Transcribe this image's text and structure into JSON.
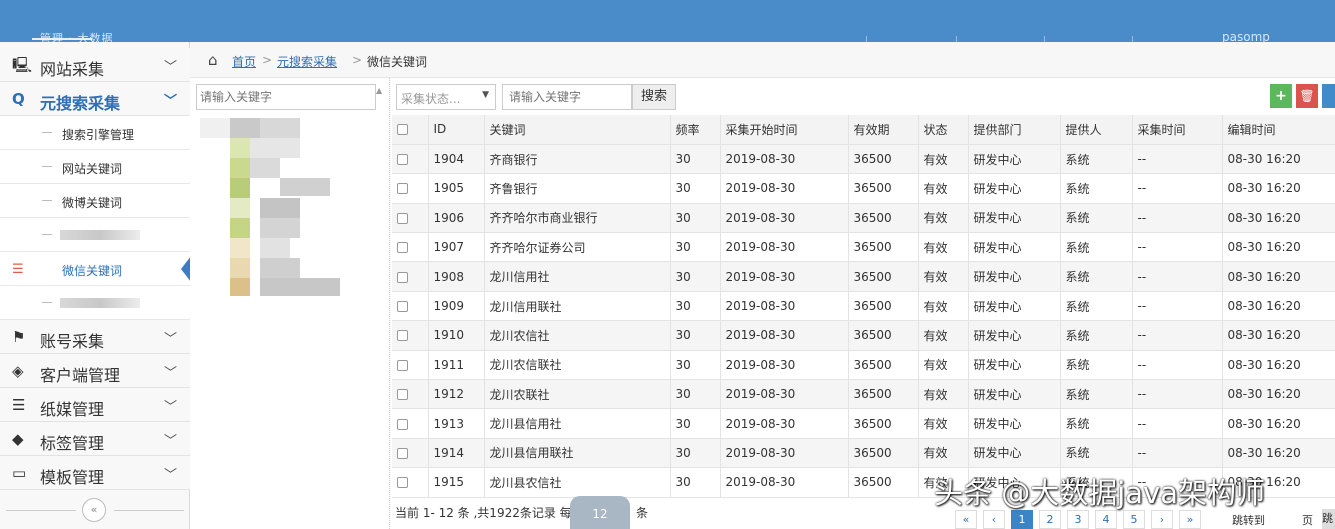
{
  "header": {
    "brand_text": "管理 · 大数据",
    "user_text": "pasomp"
  },
  "sidebar": {
    "items": [
      {
        "label": "网站采集",
        "icon": "monitor-icon",
        "glyph": "🖳"
      },
      {
        "label": "元搜索采集",
        "icon": "search-icon",
        "glyph": "Q"
      },
      {
        "label": "账号采集",
        "icon": "flag-icon",
        "glyph": "⚑"
      },
      {
        "label": "客户端管理",
        "icon": "eye-slash-icon",
        "glyph": "◈"
      },
      {
        "label": "纸媒管理",
        "icon": "newspaper-icon",
        "glyph": "☰"
      },
      {
        "label": "标签管理",
        "icon": "tag-icon",
        "glyph": "◆"
      },
      {
        "label": "模板管理",
        "icon": "monitor-icon",
        "glyph": "▭"
      }
    ],
    "sub_items": [
      {
        "label": "搜索引擎管理"
      },
      {
        "label": "网站关键词"
      },
      {
        "label": "微博关键词"
      },
      {
        "label": "微信关键词"
      }
    ],
    "collapse_glyph": "«"
  },
  "breadcrumb": {
    "home": "首页",
    "parent": "元搜索采集",
    "current": "微信关键词",
    "separator": ">"
  },
  "tree": {
    "search_placeholder": "请输入关键字"
  },
  "toolbar": {
    "status_placeholder": "采集状态...",
    "keyword_placeholder": "请输入关键字",
    "search_label": "搜索",
    "add_label": "+",
    "delete_label": "🗑"
  },
  "table": {
    "columns": [
      "ID",
      "关键词",
      "频率",
      "采集开始时间",
      "有效期",
      "状态",
      "提供部门",
      "提供人",
      "采集时间",
      "编辑时间"
    ],
    "rows": [
      [
        "1904",
        "齐商银行",
        "30",
        "2019-08-30",
        "36500",
        "有效",
        "研发中心",
        "系统",
        "--",
        "08-30 16:20"
      ],
      [
        "1905",
        "齐鲁银行",
        "30",
        "2019-08-30",
        "36500",
        "有效",
        "研发中心",
        "系统",
        "--",
        "08-30 16:20"
      ],
      [
        "1906",
        "齐齐哈尔市商业银行",
        "30",
        "2019-08-30",
        "36500",
        "有效",
        "研发中心",
        "系统",
        "--",
        "08-30 16:20"
      ],
      [
        "1907",
        "齐齐哈尔证券公司",
        "30",
        "2019-08-30",
        "36500",
        "有效",
        "研发中心",
        "系统",
        "--",
        "08-30 16:20"
      ],
      [
        "1908",
        "龙川信用社",
        "30",
        "2019-08-30",
        "36500",
        "有效",
        "研发中心",
        "系统",
        "--",
        "08-30 16:20"
      ],
      [
        "1909",
        "龙川信用联社",
        "30",
        "2019-08-30",
        "36500",
        "有效",
        "研发中心",
        "系统",
        "--",
        "08-30 16:20"
      ],
      [
        "1910",
        "龙川农信社",
        "30",
        "2019-08-30",
        "36500",
        "有效",
        "研发中心",
        "系统",
        "--",
        "08-30 16:20"
      ],
      [
        "1911",
        "龙川农信联社",
        "30",
        "2019-08-30",
        "36500",
        "有效",
        "研发中心",
        "系统",
        "--",
        "08-30 16:20"
      ],
      [
        "1912",
        "龙川农联社",
        "30",
        "2019-08-30",
        "36500",
        "有效",
        "研发中心",
        "系统",
        "--",
        "08-30 16:20"
      ],
      [
        "1913",
        "龙川县信用社",
        "30",
        "2019-08-30",
        "36500",
        "有效",
        "研发中心",
        "系统",
        "--",
        "08-30 16:20"
      ],
      [
        "1914",
        "龙川县信用联社",
        "30",
        "2019-08-30",
        "36500",
        "有效",
        "研发中心",
        "系统",
        "--",
        "08-30 16:20"
      ],
      [
        "1915",
        "龙川县农信社",
        "30",
        "2019-08-30",
        "36500",
        "有效",
        "研发中心",
        "系统",
        "--",
        "08-30 16:20"
      ]
    ]
  },
  "footer": {
    "summary": "当前 1- 12 条 ,共1922条记录 每页",
    "page_size": "12",
    "unit": "条",
    "pages": [
      "«",
      "‹",
      "1",
      "2",
      "3",
      "4",
      "5",
      "›",
      "»"
    ],
    "current_page": "1",
    "jump_label": "跳转到",
    "page_label": "页",
    "go_label": "跳"
  },
  "watermark": "头条 @大数据java架构师",
  "colors": {
    "topbar": "#4a8bc9",
    "accent": "#2e6fb5",
    "add": "#5cb85c",
    "delete": "#d9534f"
  }
}
